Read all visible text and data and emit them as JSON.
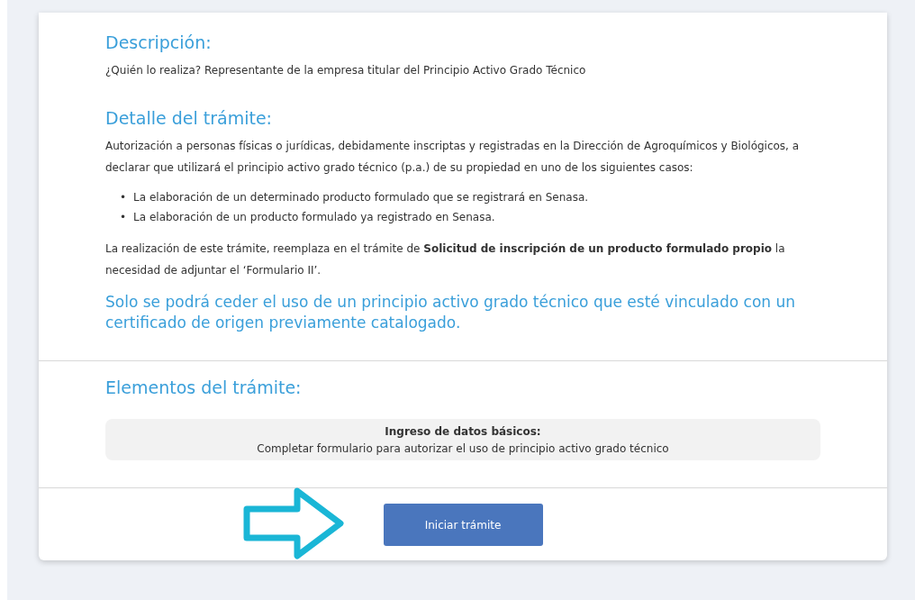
{
  "description": {
    "heading": "Descripción:",
    "text": "¿Quién lo realiza? Representante de la empresa titular del Principio Activo Grado Técnico"
  },
  "detail": {
    "heading": "Detalle del trámite:",
    "intro": "Autorización a personas físicas o jurídicas, debidamente inscriptas y registradas en la Dirección de Agroquímicos y Biológicos, a declarar que utilizará el principio activo grado técnico (p.a.) de su propiedad en uno de los siguientes casos:",
    "bullets": [
      {
        "marker": "•",
        "text": "La elaboración de un determinado producto formulado que se registrará en Senasa."
      },
      {
        "marker": "•",
        "text": "La elaboración de un producto formulado ya registrado en Senasa."
      }
    ],
    "note": "La realización de este trámite, reemplaza en el trámite de **Solicitud de inscripción de un producto formulado propio** la necesidad de adjuntar el ‘Formulario II’.",
    "highlight": "Solo se podrá ceder el uso de un principio activo grado técnico que esté vinculado con un certificado de origen previamente catalogado."
  },
  "elements": {
    "heading": "Elementos del trámite:",
    "items": [
      {
        "title": "Ingreso de datos básicos:",
        "text": "Completar formulario para autorizar el uso de principio activo grado técnico"
      }
    ]
  },
  "action": {
    "button": "Iniciar trámite"
  }
}
